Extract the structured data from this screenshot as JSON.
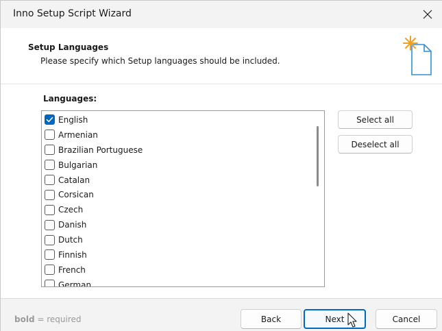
{
  "window": {
    "title": "Inno Setup Script Wizard"
  },
  "header": {
    "title": "Setup Languages",
    "subtitle": "Please specify which Setup languages should be included."
  },
  "languages": {
    "label": "Languages:",
    "items": [
      {
        "label": "English",
        "checked": true
      },
      {
        "label": "Armenian",
        "checked": false
      },
      {
        "label": "Brazilian Portuguese",
        "checked": false
      },
      {
        "label": "Bulgarian",
        "checked": false
      },
      {
        "label": "Catalan",
        "checked": false
      },
      {
        "label": "Corsican",
        "checked": false
      },
      {
        "label": "Czech",
        "checked": false
      },
      {
        "label": "Danish",
        "checked": false
      },
      {
        "label": "Dutch",
        "checked": false
      },
      {
        "label": "Finnish",
        "checked": false
      },
      {
        "label": "French",
        "checked": false
      },
      {
        "label": "German",
        "checked": false
      }
    ]
  },
  "buttons": {
    "select_all": "Select all",
    "deselect_all": "Deselect all",
    "back": "Back",
    "next": "Next",
    "cancel": "Cancel"
  },
  "footer": {
    "note_bold": "bold",
    "note_rest": " = required"
  },
  "icons": {
    "close": "close-icon",
    "wizard": "new-document-spark-icon",
    "check": "checkmark-icon",
    "cursor": "mouse-pointer-icon"
  },
  "colors": {
    "accent": "#0067c0",
    "spark": "#f0a020",
    "doc": "#2d8fd6"
  }
}
